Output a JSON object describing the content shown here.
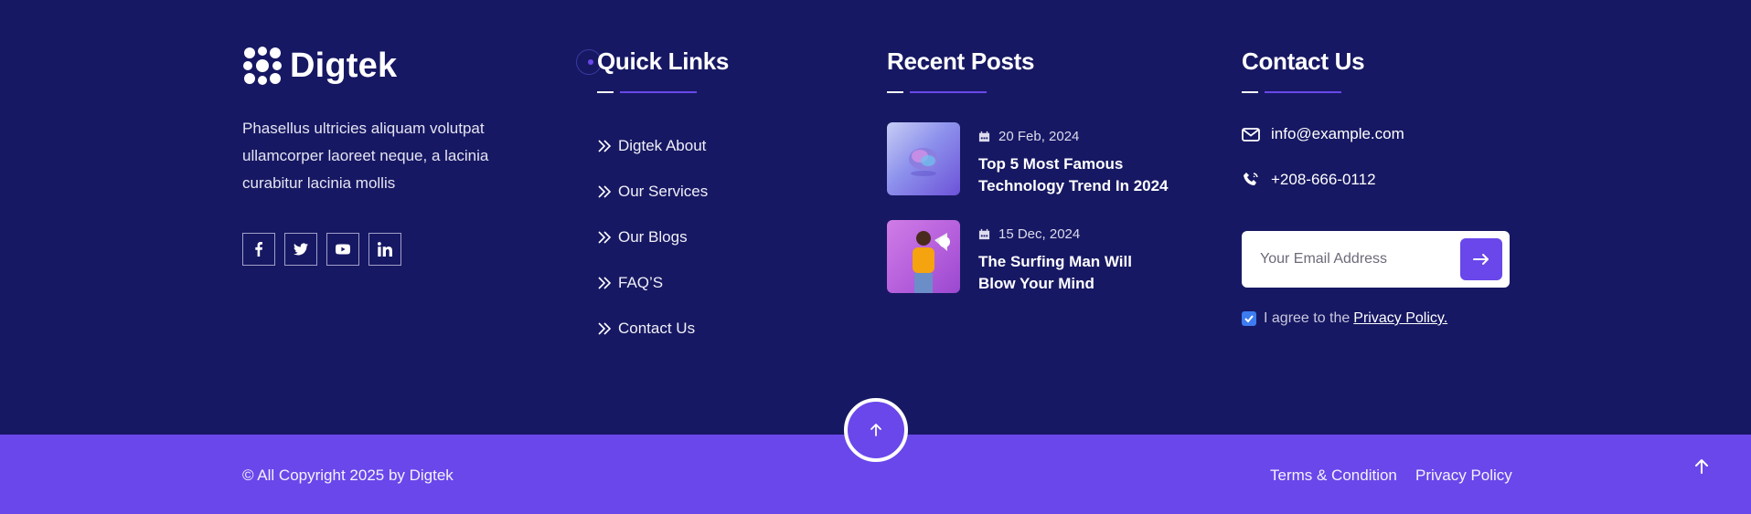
{
  "brand": {
    "name": "Digtek",
    "accent": "#6a47ea",
    "background": "#171863"
  },
  "about": {
    "text": "Phasellus ultricies aliquam volutpat ullamcorper laoreet neque, a lacinia curabitur lacinia mollis"
  },
  "socials": [
    {
      "icon": "facebook-icon"
    },
    {
      "icon": "twitter-icon"
    },
    {
      "icon": "youtube-icon"
    },
    {
      "icon": "linkedin-icon"
    }
  ],
  "quick_links": {
    "title": "Quick Links",
    "items": [
      {
        "label": "Digtek About"
      },
      {
        "label": "Our Services"
      },
      {
        "label": "Our Blogs"
      },
      {
        "label": "FAQ’S"
      },
      {
        "label": "Contact Us"
      }
    ]
  },
  "recent_posts": {
    "title": "Recent Posts",
    "items": [
      {
        "date": "20 Feb, 2024",
        "title": "Top 5 Most Famous Technology Trend In 2024"
      },
      {
        "date": "15 Dec, 2024",
        "title": "The Surfing Man Will Blow Your Mind"
      }
    ]
  },
  "contact": {
    "title": "Contact Us",
    "email": "info@example.com",
    "phone": "+208-666-0112",
    "email_placeholder": "Your Email Address",
    "agree_text": "I agree to the",
    "agree_link": "Privacy Policy."
  },
  "bottom": {
    "copyright": "© All Copyright 2025 by Digtek",
    "links": [
      {
        "label": "Terms & Condition"
      },
      {
        "label": "Privacy Policy"
      }
    ]
  }
}
